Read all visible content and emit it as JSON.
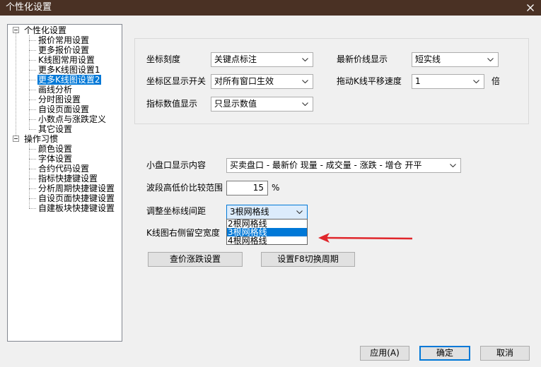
{
  "window": {
    "title": "个性化设置",
    "close_icon": "close-icon"
  },
  "colors": {
    "title_bar": "#4a3124",
    "selection": "#0078d7",
    "annotation_arrow": "#e0262b"
  },
  "tree": {
    "selected": {
      "group": 0,
      "child": 4
    },
    "groups": [
      {
        "label": "个性化设置",
        "expanded": true,
        "children": [
          "报价常用设置",
          "更多报价设置",
          "K线图常用设置",
          "更多K线图设置1",
          "更多K线图设置2",
          "画线分析",
          "分时图设置",
          "自设页面设置",
          "小数点与涨跌定义",
          "其它设置"
        ]
      },
      {
        "label": "操作习惯",
        "expanded": true,
        "children": [
          "颜色设置",
          "字体设置",
          "合约代码设置",
          "指标快捷键设置",
          "分析周期快捷键设置",
          "自设页面快捷键设置",
          "自建板块快捷键设置"
        ]
      }
    ]
  },
  "settings": {
    "axis_scale": {
      "label": "坐标刻度",
      "value": "关键点标注"
    },
    "latest_price_line": {
      "label": "最新价线显示",
      "value": "短实线"
    },
    "axis_area_toggle": {
      "label": "坐标区显示开关",
      "value": "对所有窗口生效"
    },
    "kline_drag_speed": {
      "label": "拖动K线平移速度",
      "value": "1",
      "unit": "倍"
    },
    "indicator_value_display": {
      "label": "指标数值显示",
      "value": "只显示数值"
    },
    "mini_quote_content": {
      "label": "小盘口显示内容",
      "value": "买卖盘口 - 最新价 现量 - 成交量 - 涨跌 - 增仓 开平"
    },
    "wave_range": {
      "label": "波段高低价比较范围",
      "value": "15",
      "unit": "%"
    },
    "grid_spacing": {
      "label": "调整坐标线间距",
      "value": "3根网格线",
      "open": true,
      "highlighted_index": 1,
      "options": [
        "2根网格线",
        "3根网格线",
        "4根网格线"
      ]
    },
    "kline_right_margin": {
      "label": "K线图右侧留空宽度"
    }
  },
  "buttons": {
    "price_change": "查价涨跌设置",
    "f8_cycle": "设置F8切换周期",
    "apply": "应用(A)",
    "ok": "确定",
    "cancel": "取消"
  }
}
